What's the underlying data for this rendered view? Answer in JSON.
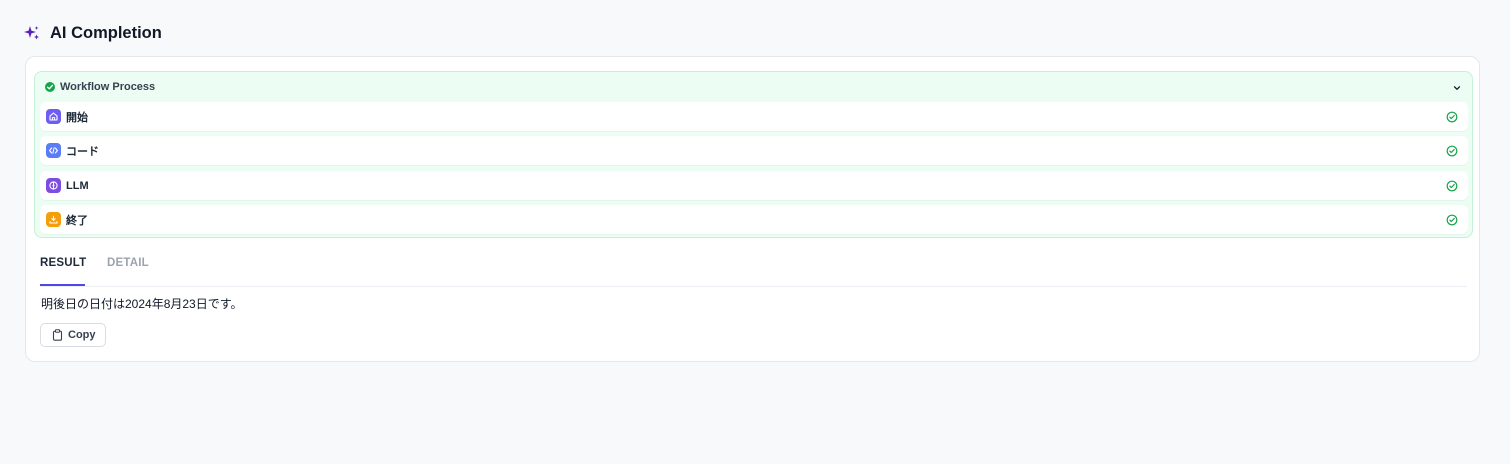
{
  "header": {
    "title": "AI Completion",
    "icon": "sparkle-icon"
  },
  "workflow": {
    "title": "Workflow Process",
    "status": "succeeded",
    "nodes": [
      {
        "label": "開始",
        "icon": "home-icon",
        "color": "#6d5ef0",
        "status": "succeeded"
      },
      {
        "label": "コード",
        "icon": "code-icon",
        "color": "#5b7cf5",
        "status": "succeeded"
      },
      {
        "label": "LLM",
        "icon": "llm-icon",
        "color": "#7c4ddf",
        "status": "succeeded"
      },
      {
        "label": "終了",
        "icon": "end-flag-icon",
        "color": "#f59e0b",
        "status": "succeeded"
      }
    ]
  },
  "tabs": [
    {
      "label": "RESULT",
      "active": true
    },
    {
      "label": "DETAIL",
      "active": false
    }
  ],
  "result": {
    "text": "明後日の日付は2024年8月23日です。"
  },
  "copy_button": {
    "label": "Copy",
    "icon": "clipboard-icon"
  },
  "colors": {
    "accent": "#4f46e5",
    "success": "#16a34a",
    "workflow_bg": "#ecfdf3"
  }
}
